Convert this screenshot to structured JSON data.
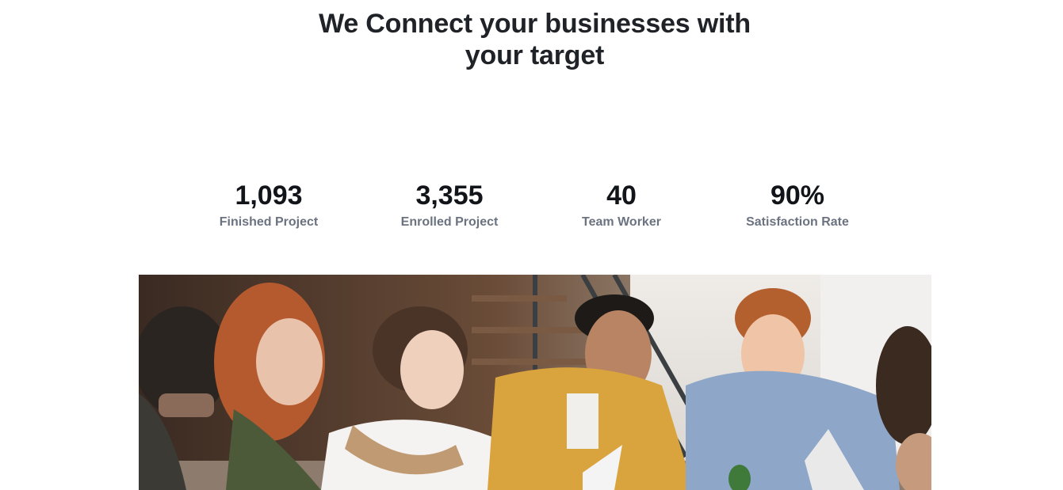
{
  "headline": {
    "line1": "We Connect your businesses with",
    "line2": "your target"
  },
  "stats": [
    {
      "value": "1,093",
      "label": "Finished Project"
    },
    {
      "value": "3,355",
      "label": "Enrolled Project"
    },
    {
      "value": "40",
      "label": "Team Worker"
    },
    {
      "value": "90%",
      "label": "Satisfaction Rate"
    }
  ],
  "photo": {
    "subject": "team-meeting-photo"
  }
}
